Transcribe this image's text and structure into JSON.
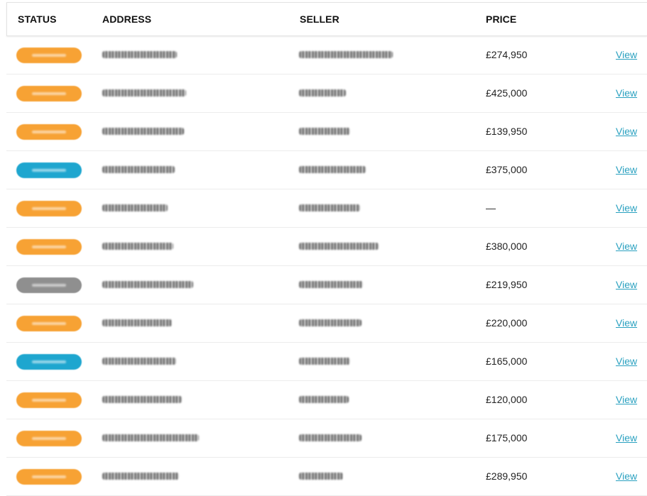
{
  "headers": {
    "status": "STATUS",
    "address": "ADDRESS",
    "seller": "SELLER",
    "price": "PRICE"
  },
  "status_colors": {
    "orange": "#f7a234",
    "blue": "#1ea6cf",
    "grey": "#8f8f8f"
  },
  "rows": [
    {
      "status_color": "orange",
      "price": "£274,950",
      "action": "View"
    },
    {
      "status_color": "orange",
      "price": "£425,000",
      "action": "View"
    },
    {
      "status_color": "orange",
      "price": "£139,950",
      "action": "View"
    },
    {
      "status_color": "blue",
      "price": "£375,000",
      "action": "View"
    },
    {
      "status_color": "orange",
      "price": "—",
      "action": "View"
    },
    {
      "status_color": "orange",
      "price": "£380,000",
      "action": "View"
    },
    {
      "status_color": "grey",
      "price": "£219,950",
      "action": "View"
    },
    {
      "status_color": "orange",
      "price": "£220,000",
      "action": "View"
    },
    {
      "status_color": "blue",
      "price": "£165,000",
      "action": "View"
    },
    {
      "status_color": "orange",
      "price": "£120,000",
      "action": "View"
    },
    {
      "status_color": "orange",
      "price": "£175,000",
      "action": "View"
    },
    {
      "status_color": "orange",
      "price": "£289,950",
      "action": "View"
    }
  ]
}
